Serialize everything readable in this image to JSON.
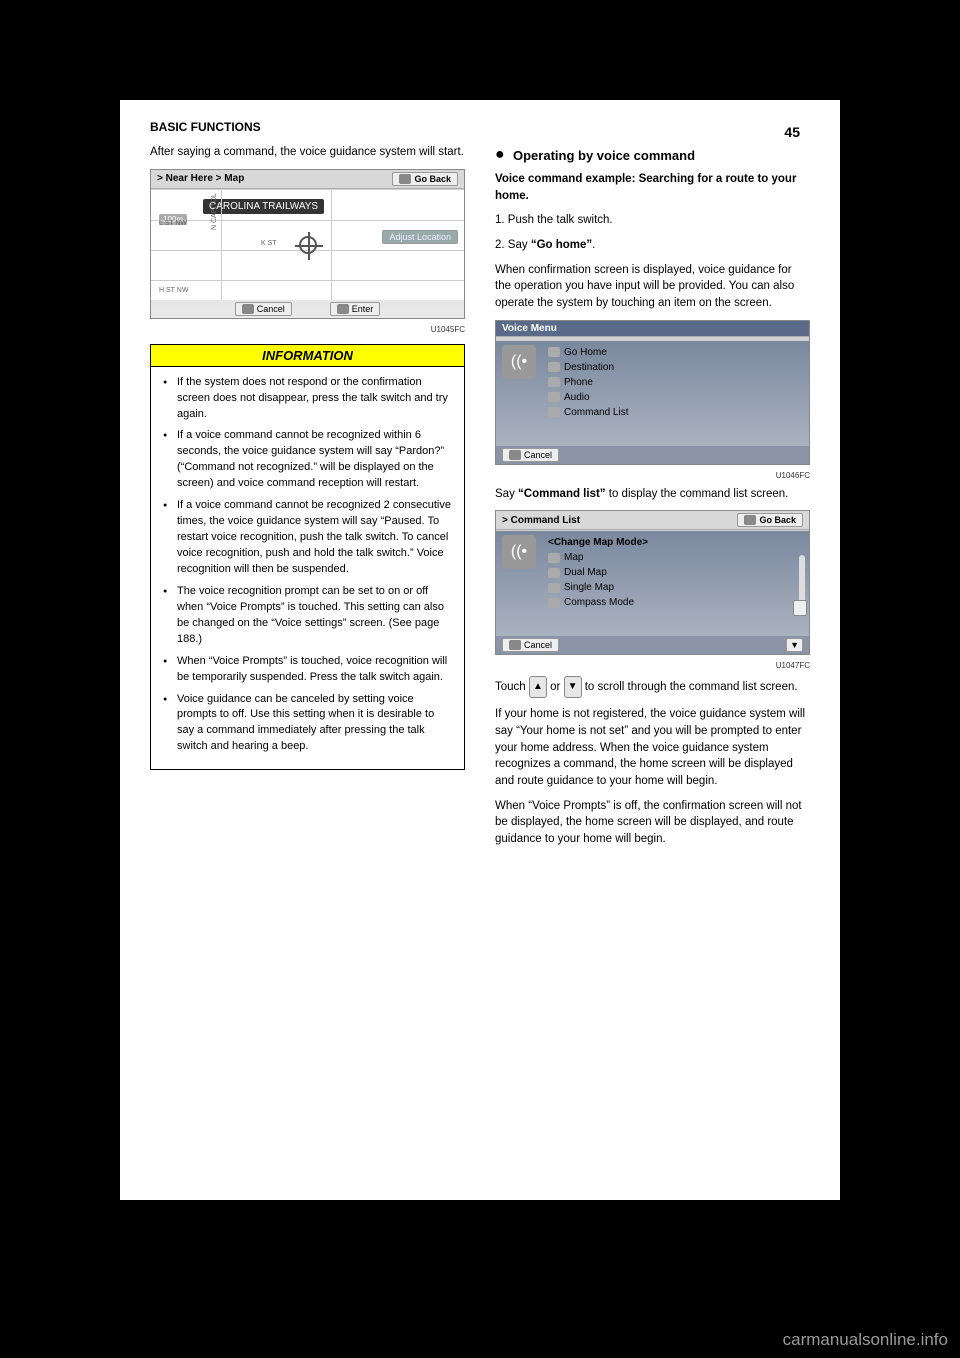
{
  "header": {
    "section_label": "BASIC FUNCTIONS",
    "page_number": "45"
  },
  "left": {
    "intro_paragraph": "After saying a command, the voice guidance system will start.",
    "s1": {
      "title": "Near Here",
      "subtitle": "Map",
      "goback": "Go Back"
    },
    "s1_scale": "100m",
    "s1_banner": "CAROLINA TRAILWAYS",
    "s1_cancel": "Cancel",
    "s1_enter": "Enter",
    "s1_roads": {
      "a": "L ST NW",
      "b": "H ST NW",
      "c": "K ST",
      "d": "N CAPITOL"
    },
    "s1_adjust": "Adjust Location",
    "s1_code": "U1045FC",
    "info": {
      "heading": "INFORMATION",
      "items": [
        "If the system does not respond or the confirmation screen does not disappear, press the talk switch and try again.",
        "If a voice command cannot be recognized within 6 seconds, the voice guidance system will say “Pardon?” (“Command not recognized.” will be displayed on the screen) and voice command reception will restart.",
        "If a voice command cannot be recognized 2 consecutive times, the voice guidance system will say “Paused. To restart voice recognition, push the talk switch. To cancel voice recognition, push and hold the talk switch.” Voice recognition will then be suspended.",
        "The voice recognition prompt can be set to on or off when “Voice Prompts” is touched. This setting can also be changed on the “Voice settings” screen. (See page 188.)",
        "When “Voice Prompts” is touched, voice recognition will be temporarily suspended. Press the talk switch again.",
        "Voice guidance can be canceled by setting voice prompts to off. Use this setting when it is desirable to say a command immediately after pressing the talk switch and hearing a beep."
      ]
    }
  },
  "right": {
    "heading": "Voice command example: Searching for a route to your home.",
    "step1": "1. Push the talk switch.",
    "step2a": "2. Say",
    "step2b": "“Go home”",
    "step2c": ".",
    "para_confirm": "When confirmation screen is displayed, voice guidance for the operation you have input will be provided. You can also operate the system by touching an item on the screen.",
    "s2_title": "Voice Menu",
    "s2_items": [
      "Go Home",
      "Destination",
      "Phone",
      "Audio",
      "Command List"
    ],
    "s2_cancel": "Cancel",
    "s2_code": "U1046FC",
    "para_say_cmd": "Say “Command list” to display the command list screen.",
    "s3_title": "Command List",
    "s3_goback": "Go Back",
    "s3_group": "<Change Map Mode>",
    "s3_items": [
      "Map",
      "Dual Map",
      "Single Map",
      "Compass Mode"
    ],
    "s3_cancel": "Cancel",
    "s3_code": "U1047FC",
    "para_touch_a": "Touch ",
    "para_touch_b": " or ",
    "para_touch_c": " to scroll through the command list screen.",
    "para_home_a": "If your home is not registered, the voice guidance system will say “Your home is not set” and you will be prompted to enter your home address. ",
    "para_home_b": "When the voice guidance system recognizes a command, the home screen will be displayed and route guidance to your home will begin.",
    "para_prompts_off": "When “Voice Prompts” is off, the confirmation screen will not be displayed, the home screen will be displayed, and route guidance to your home will begin.",
    "section_bullet_label": "Operating by voice command"
  },
  "watermark": "carmanualsonline.info"
}
